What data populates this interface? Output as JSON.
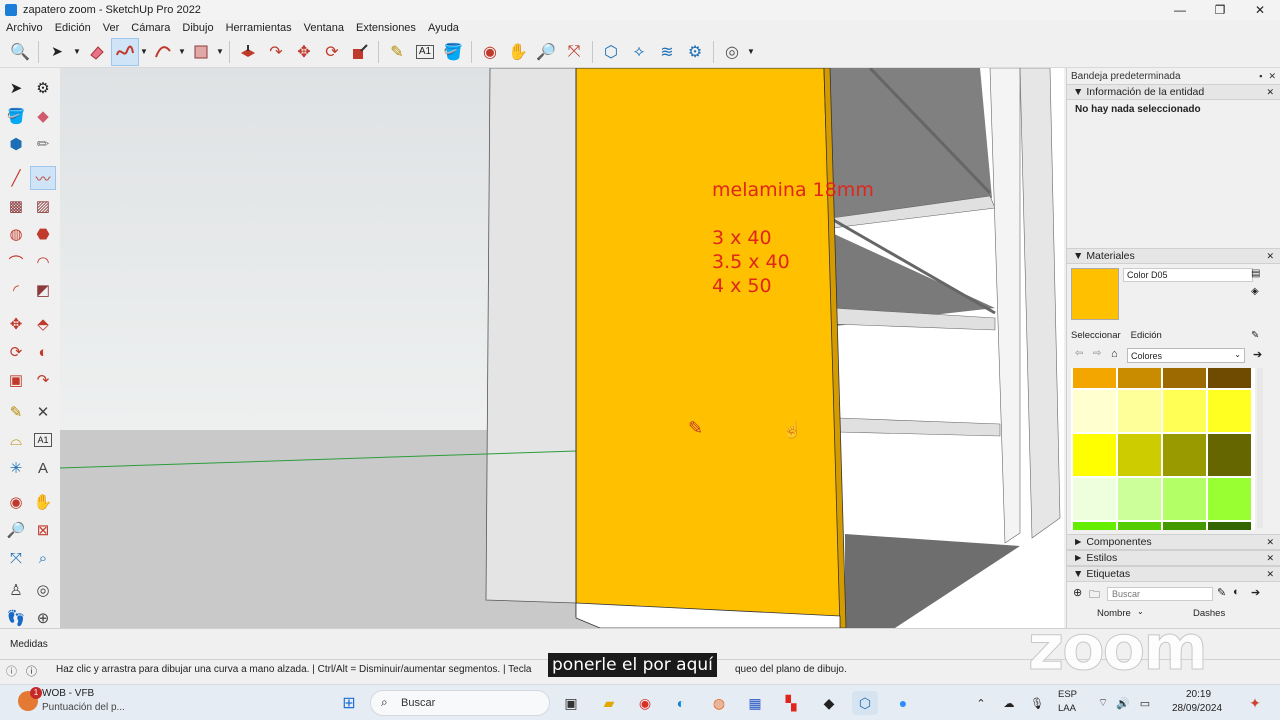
{
  "window": {
    "title": "zapatero zoom - SketchUp Pro 2022",
    "controls": [
      "—",
      "❐",
      "✕"
    ]
  },
  "menu": [
    "Archivo",
    "Edición",
    "Ver",
    "Cámara",
    "Dibujo",
    "Herramientas",
    "Ventana",
    "Extensiones",
    "Ayuda"
  ],
  "model_text": {
    "line1": "melamina 18mm",
    "line2": "3 x 40",
    "line3": "3.5 x 40",
    "line4": "4 x 50"
  },
  "tray": {
    "title": "Bandeja predeterminada",
    "entity_info": {
      "title": "Información de la entidad",
      "status": "No hay nada seleccionado"
    },
    "materials": {
      "title": "Materiales",
      "current_name": "Color D05",
      "current_color": "#ffc000",
      "tab_select": "Seleccionar",
      "tab_edit": "Edición",
      "library": "Colores",
      "swatches": [
        "#f4a600",
        "#c98b00",
        "#9c6a00",
        "#6e4b00",
        "#ffffd0",
        "#ffff99",
        "#ffff55",
        "#ffff22",
        "#ffff00",
        "#cccc00",
        "#999900",
        "#666600",
        "#eeffdd",
        "#ccff99",
        "#b2ff66",
        "#99ff33",
        "#66ee00",
        "#55cc00",
        "#449900",
        "#336600"
      ]
    },
    "components": "Componentes",
    "styles": "Estilos",
    "tags": {
      "title": "Etiquetas",
      "search_placeholder": "Buscar",
      "col_name": "Nombre",
      "col_dashes": "Dashes"
    }
  },
  "measure_label": "Medidas",
  "status_text": "Haz clic y arrastra para dibujar una curva a mano alzada. | Ctrl/Alt = Disminuir/aumentar segmentos. | Tecla ",
  "status_text_tail": "queo del plano de dibujo.",
  "caption": "ponerle el por aquí",
  "zoom_watermark": "zoom",
  "taskbar": {
    "notif_count": "1",
    "app_title": "WOB - VFB",
    "app_sub": "Puntuación del p...",
    "search": "Buscar",
    "lang": "ESP",
    "lang2": "LAA",
    "time": "20:19",
    "date": "28/09/2024"
  }
}
